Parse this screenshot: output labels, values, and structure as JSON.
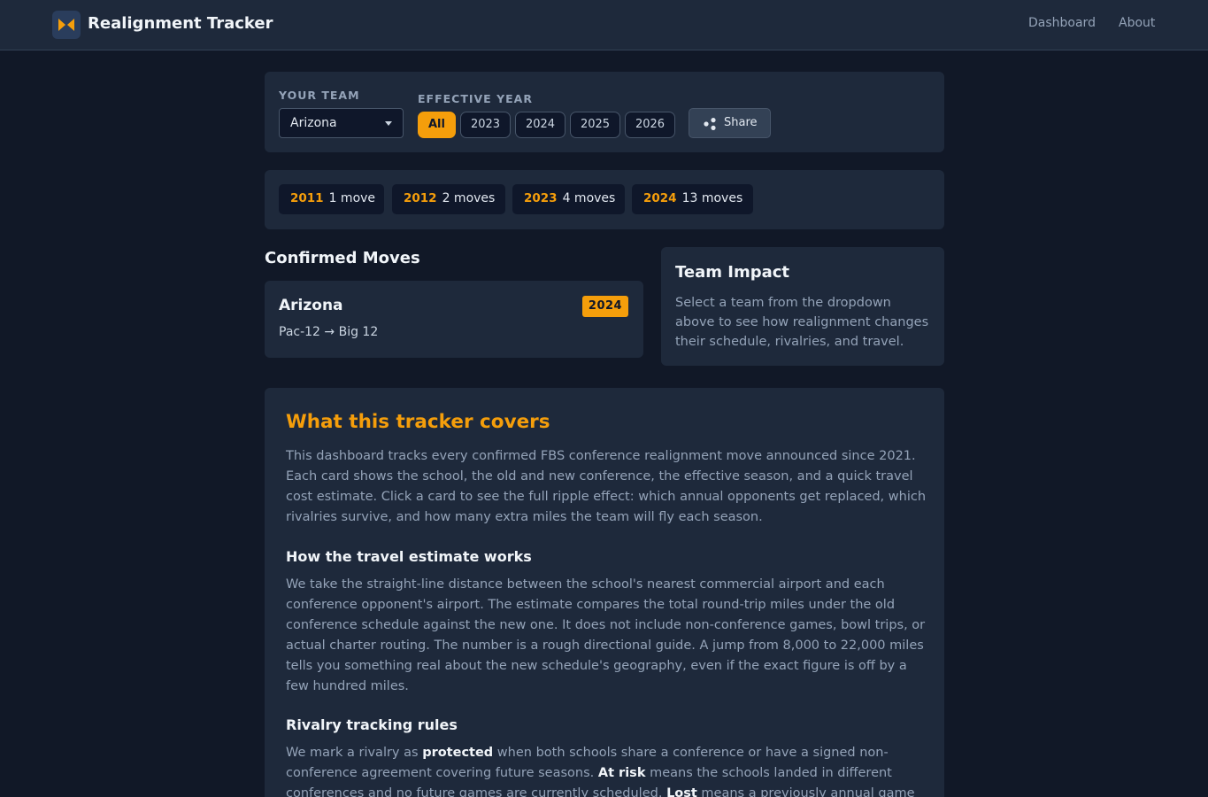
{
  "app": {
    "title": "Realignment Tracker",
    "nav": [
      "Dashboard",
      "About"
    ]
  },
  "filters": {
    "team_label": "YOUR TEAM",
    "team_value": "Arizona",
    "year_label": "EFFECTIVE YEAR",
    "year_options": [
      "All",
      "2023",
      "2024",
      "2025",
      "2026"
    ],
    "year_selected": "All",
    "share_label": "Share"
  },
  "timeline": [
    {
      "year": "2011",
      "count": "1 move"
    },
    {
      "year": "2012",
      "count": "2 moves"
    },
    {
      "year": "2023",
      "count": "4 moves"
    },
    {
      "year": "2024",
      "count": "13 moves"
    }
  ],
  "confirmed": {
    "heading": "Confirmed Moves",
    "card": {
      "school": "Arizona",
      "year": "2024",
      "move": "Pac-12 → Big 12"
    }
  },
  "impact": {
    "heading": "Team Impact",
    "lines": [
      "Select a team from the dropdown",
      "above to see how realignment changes",
      "their schedule, rivalries, and travel."
    ]
  },
  "about": {
    "heading": "What this tracker covers",
    "intro": [
      "This dashboard tracks every confirmed FBS conference realignment move announced since 2021.",
      "Each card shows the school, the old and new conference, the effective season, and a quick travel",
      "cost estimate. Click a card to see the full ripple effect: which annual opponents get replaced, which",
      "rivalries survive, and how many extra miles the team will fly each season."
    ],
    "travel_heading": "How the travel estimate works",
    "travel": [
      "We take the straight-line distance between the school's nearest commercial airport and each",
      "conference opponent's airport. The estimate compares the total round-trip miles under the old",
      "conference schedule against the new one. It does not include non-conference games, bowl trips, or",
      "actual charter routing. The number is a rough directional guide. A jump from 8,000 to 22,000 miles",
      "tells you something real about the new schedule's geography, even if the exact figure is off by a",
      "few hundred miles."
    ],
    "rivalry_heading": "Rivalry tracking rules",
    "rivalry": {
      "l1_a": "We mark a rivalry as ",
      "l1_b": "protected",
      "l1_c": " when both schools share a conference or have a signed non-",
      "l2_a": "conference agreement covering future seasons. ",
      "l2_b": "At risk",
      "l2_c": " means the schools landed in different",
      "l3_a": "conferences and no future games are currently scheduled. ",
      "l3_b": "Lost",
      "l3_c": " means a previously annual game"
    }
  },
  "colors": {
    "accent": "#f59e0b",
    "background": "#111827",
    "panel": "#1e293b"
  }
}
